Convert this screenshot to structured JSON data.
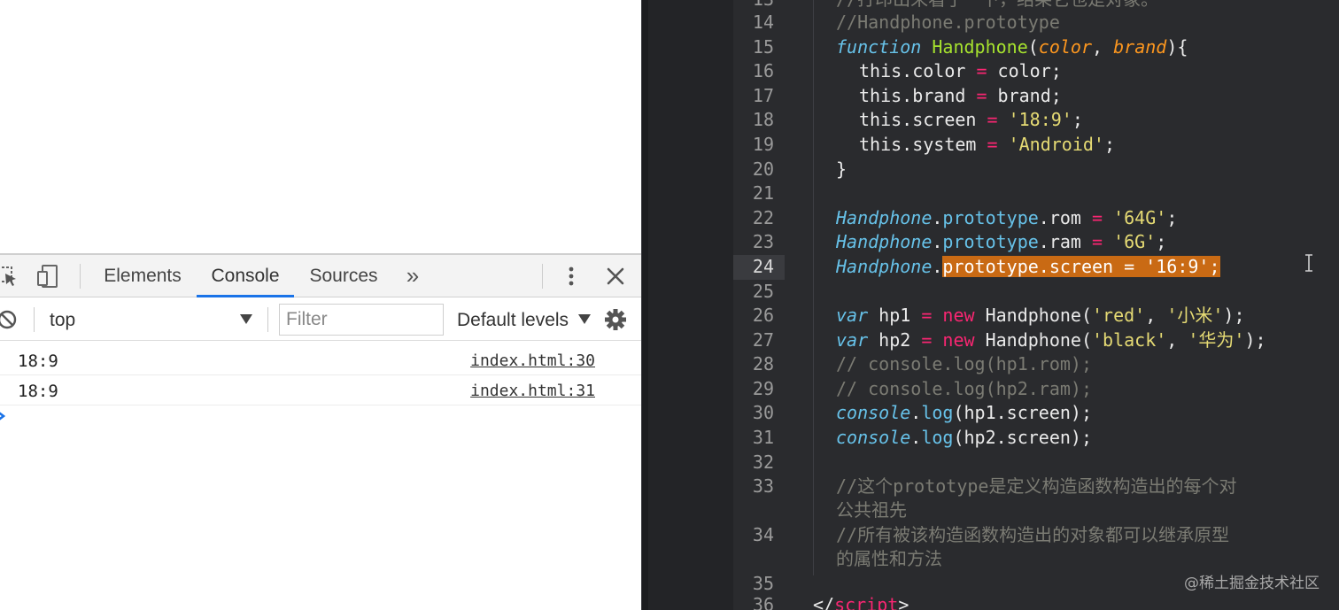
{
  "devtools": {
    "tabs": {
      "elements": "Elements",
      "console": "Console",
      "sources": "Sources",
      "more": "»"
    },
    "filterbar": {
      "context": "top",
      "filter_placeholder": "Filter",
      "levels": "Default levels"
    },
    "console_rows": [
      {
        "message": "18:9",
        "source": "index.html:30"
      },
      {
        "message": "18:9",
        "source": "index.html:31"
      }
    ],
    "accent_color": "#1a73e8"
  },
  "editor": {
    "line_numbers": [
      "13",
      "14",
      "15",
      "16",
      "17",
      "18",
      "19",
      "20",
      "21",
      "22",
      "23",
      "24",
      "25",
      "26",
      "27",
      "28",
      "29",
      "30",
      "31",
      "32",
      "33",
      "34",
      "35",
      "36"
    ],
    "active_line": "24",
    "lines": {
      "l13_comment": "//打印出来看了一下，结果它也是对象。",
      "l14_comment": "//Handphone.prototype",
      "l15_kw": "function",
      "l15_name": "Handphone",
      "l15_open": "(",
      "l15_p1": "color",
      "l15_comma": ", ",
      "l15_p2": "brand",
      "l15_close": "){",
      "l16_this": "this.color",
      "l16_eq": " = ",
      "l16_val": "color;",
      "l17_this": "this.brand",
      "l17_eq": " = ",
      "l17_val": "brand;",
      "l18_this": "this.screen",
      "l18_eq": " = ",
      "l18_val": "'18:9'",
      "l18_end": ";",
      "l19_this": "this.system",
      "l19_eq": " = ",
      "l19_val": "'Android'",
      "l19_end": ";",
      "l20": "}",
      "l22_obj": "Handphone",
      "l22_dot": ".",
      "l22_proto": "prototype",
      "l22_rest": ".rom",
      "l22_eq": " = ",
      "l22_val": "'64G'",
      "l22_end": ";",
      "l23_obj": "Handphone",
      "l23_dot": ".",
      "l23_proto": "prototype",
      "l23_rest": ".ram",
      "l23_eq": " = ",
      "l23_val": "'6G'",
      "l23_end": ";",
      "l24_obj": "Handphone",
      "l24_dot": ".",
      "l24_selected": "prototype.screen = '16:9';",
      "l26_kw": "var",
      "l26_var": " hp1",
      "l26_eq": " = ",
      "l26_new": "new",
      "l26_call": " Handphone(",
      "l26_a1": "'red'",
      "l26_comma": ", ",
      "l26_a2": "'小米'",
      "l26_end": ");",
      "l27_kw": "var",
      "l27_var": " hp2",
      "l27_eq": " = ",
      "l27_new": "new",
      "l27_call": " Handphone(",
      "l27_a1": "'black'",
      "l27_comma": ", ",
      "l27_a2": "'华为'",
      "l27_end": ");",
      "l28_comment": "// console.log(hp1.rom);",
      "l29_comment": "// console.log(hp2.ram);",
      "l30_obj": "console",
      "l30_dot": ".",
      "l30_fn": "log",
      "l30_rest": "(hp1.screen);",
      "l31_obj": "console",
      "l31_dot": ".",
      "l31_fn": "log",
      "l31_rest": "(hp2.screen);",
      "l33_comment_a": "//这个prototype是定义构造函数构造出的每个对",
      "l33_comment_b": "公共祖先",
      "l34_comment_a": "//所有被该构造函数构造出的对象都可以继承原型",
      "l34_comment_b": "的属性和方法",
      "l36_open": "</",
      "l36_tag": "script",
      "l36_close": ">"
    },
    "colors": {
      "background": "#2a2b2e",
      "keyword": "#67c2e9",
      "function_name": "#a6e22e",
      "parameter": "#fd971f",
      "string": "#e6db74",
      "operator": "#f92672",
      "comment": "#7b7b73",
      "selection": "#c96a14"
    }
  },
  "watermark": "@稀土掘金技术社区"
}
